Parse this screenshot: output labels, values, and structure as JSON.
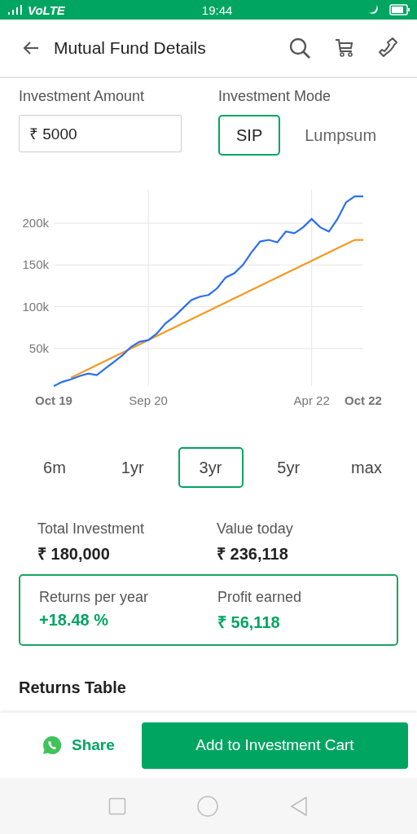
{
  "status_bar": {
    "network": "VoLTE",
    "time": "19:44"
  },
  "header": {
    "title": "Mutual Fund Details"
  },
  "investment_amount": {
    "label": "Investment Amount",
    "value": "₹ 5000"
  },
  "investment_mode": {
    "label": "Investment Mode",
    "options": [
      {
        "label": "SIP",
        "selected": true
      },
      {
        "label": "Lumpsum",
        "selected": false
      }
    ]
  },
  "chart_data": {
    "type": "line",
    "categories": [
      "Oct 19",
      null,
      null,
      null,
      null,
      null,
      null,
      null,
      null,
      null,
      null,
      "Sep 20",
      null,
      null,
      null,
      null,
      null,
      null,
      null,
      null,
      null,
      null,
      null,
      null,
      null,
      null,
      null,
      null,
      null,
      null,
      "Apr 22",
      null,
      null,
      null,
      null,
      null,
      "Oct 22"
    ],
    "ylim": [
      5000,
      240000
    ],
    "grid": true,
    "yticks": [
      {
        "value": 50000,
        "label": "50k"
      },
      {
        "value": 100000,
        "label": "100k"
      },
      {
        "value": 150000,
        "label": "150k"
      },
      {
        "value": 200000,
        "label": "200k"
      }
    ],
    "series": [
      {
        "color": "#2a6ff0",
        "values": [
          5000,
          10000,
          13000,
          17000,
          20000,
          18000,
          26000,
          34000,
          42000,
          52000,
          58000,
          60000,
          68000,
          80000,
          88000,
          98000,
          108000,
          112000,
          114000,
          122000,
          135000,
          140000,
          150000,
          165000,
          178000,
          180000,
          177000,
          190000,
          188000,
          195000,
          205000,
          195000,
          190000,
          205000,
          225000,
          232000,
          232000
        ]
      },
      {
        "color": "#f39a1f",
        "values": [
          null,
          null,
          15000,
          20000,
          25000,
          30000,
          35000,
          40000,
          45000,
          50000,
          55000,
          60000,
          65000,
          70000,
          75000,
          80000,
          85000,
          90000,
          95000,
          100000,
          105000,
          110000,
          115000,
          120000,
          125000,
          130000,
          135000,
          140000,
          145000,
          150000,
          155000,
          160000,
          165000,
          170000,
          175000,
          180000,
          180000
        ]
      }
    ]
  },
  "periods": [
    {
      "label": "6m",
      "selected": false
    },
    {
      "label": "1yr",
      "selected": false
    },
    {
      "label": "3yr",
      "selected": true
    },
    {
      "label": "5yr",
      "selected": false
    },
    {
      "label": "max",
      "selected": false
    }
  ],
  "summary": [
    {
      "label": "Total Investment",
      "value": "₹ 180,000"
    },
    {
      "label": "Value today",
      "value": "₹ 236,118"
    }
  ],
  "returns": [
    {
      "label": "Returns per year",
      "value": "+18.48 %"
    },
    {
      "label": "Profit earned",
      "value": "₹ 56,118"
    }
  ],
  "section_title": "Returns Table",
  "footer": {
    "share": "Share",
    "cta": "Add to Investment Cart"
  }
}
